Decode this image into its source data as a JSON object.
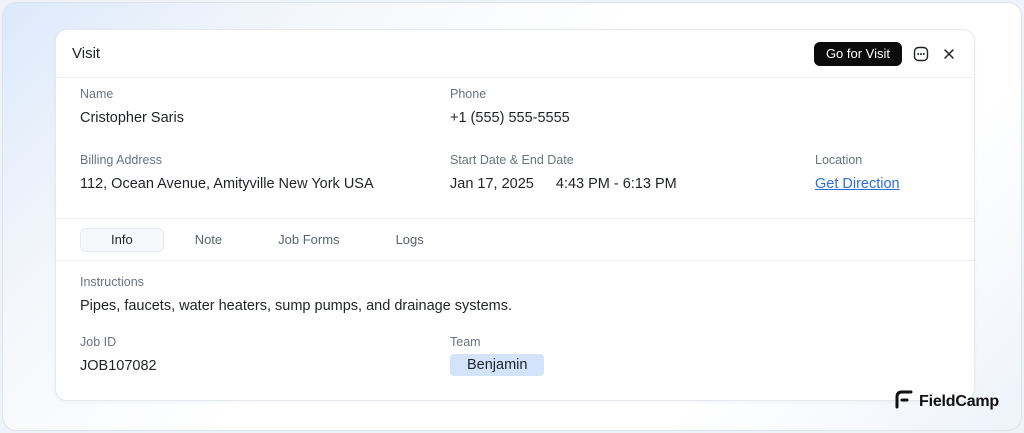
{
  "dialog": {
    "title": "Visit",
    "primary_action": "Go for Visit",
    "more_icon": "more-dots-icon",
    "close_icon": "close-icon"
  },
  "details": {
    "name_label": "Name",
    "name_value": "Cristopher Saris",
    "phone_label": "Phone",
    "phone_value": "+1 (555) 555-5555",
    "billing_label": "Billing Address",
    "billing_value": "112, Ocean Avenue, Amityville New York USA",
    "dates_label": "Start Date & End Date",
    "date_value": "Jan 17, 2025",
    "time_value": "4:43 PM - 6:13 PM",
    "location_label": "Location",
    "location_link": "Get Direction"
  },
  "tabs": [
    {
      "label": "Info",
      "active": true
    },
    {
      "label": "Note",
      "active": false
    },
    {
      "label": "Job Forms",
      "active": false
    },
    {
      "label": "Logs",
      "active": false
    }
  ],
  "info": {
    "instructions_label": "Instructions",
    "instructions_value": "Pipes, faucets, water heaters, sump pumps, and drainage systems.",
    "job_id_label": "Job ID",
    "job_id_value": "JOB107082",
    "team_label": "Team",
    "team_value": "Benjamin"
  },
  "brand": {
    "name": "FieldCamp",
    "icon": "fieldcamp-logo-icon"
  },
  "colors": {
    "link": "#2d6fd6",
    "badge_bg": "#d3e4fa",
    "primary_button": "#0b0b0c"
  }
}
